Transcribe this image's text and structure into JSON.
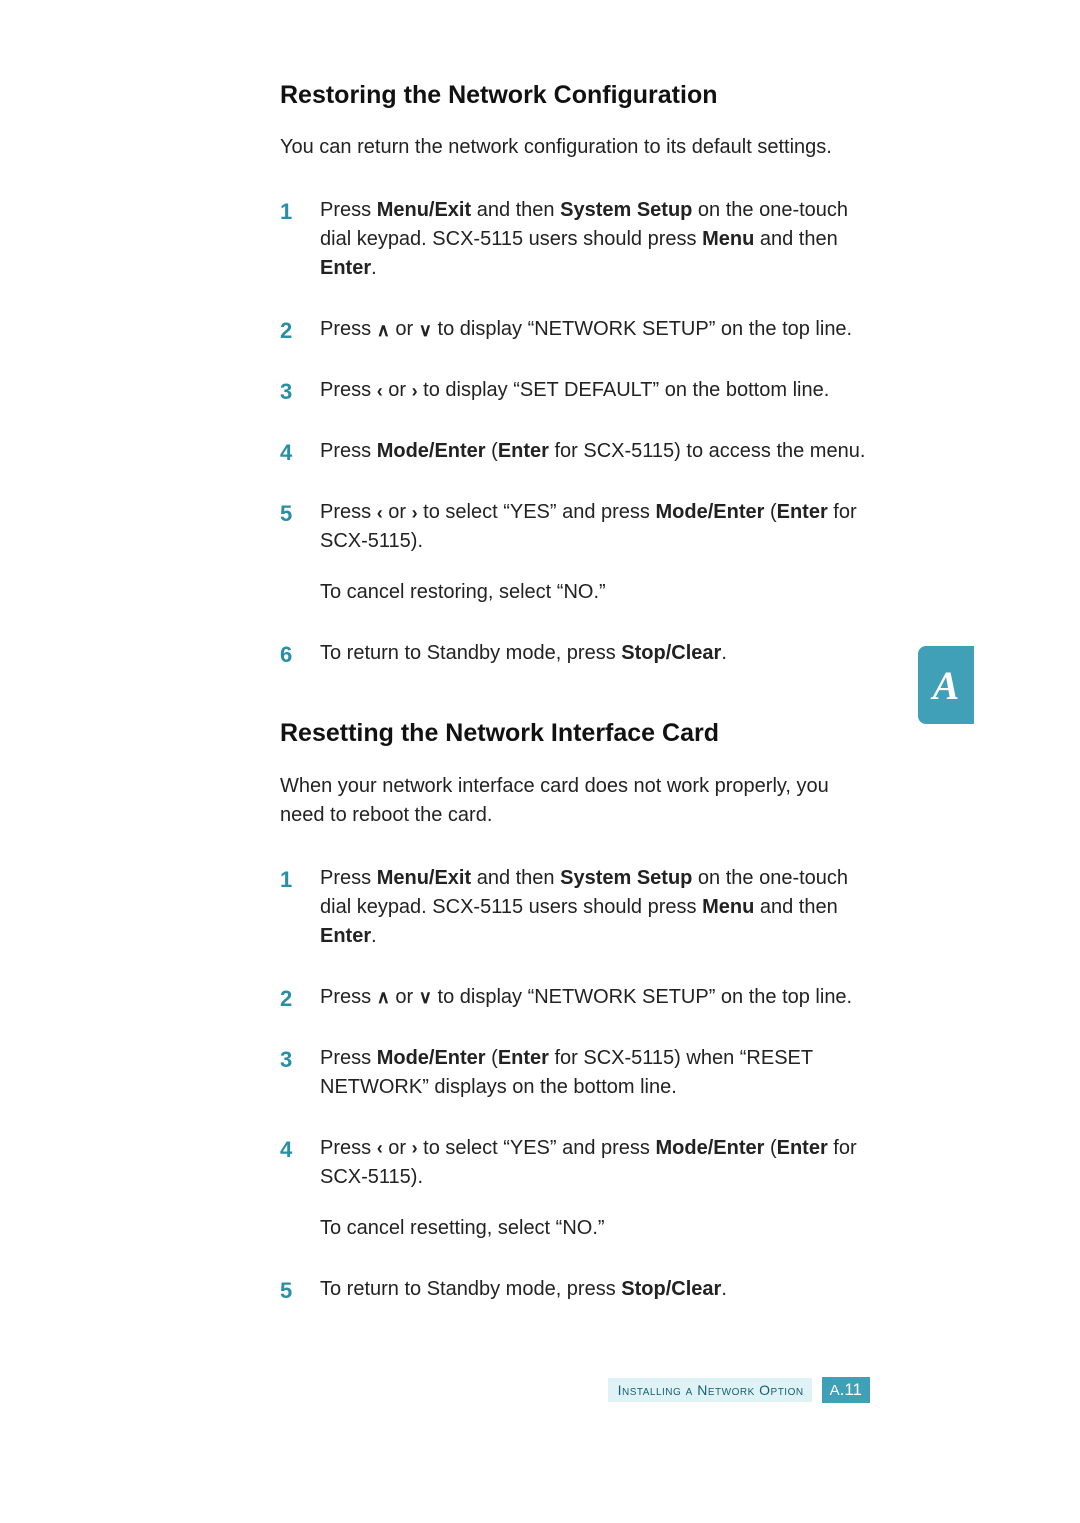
{
  "section1": {
    "heading": "Restoring the Network Configuration",
    "intro": "You can return the network configuration to its default settings.",
    "steps": [
      {
        "num": "1",
        "parts": [
          {
            "t": "Press "
          },
          {
            "t": "Menu/Exit",
            "b": true
          },
          {
            "t": " and then "
          },
          {
            "t": "System Setup",
            "b": true
          },
          {
            "t": " on the one-touch dial keypad. SCX-5115 users should press "
          },
          {
            "t": "Menu",
            "b": true
          },
          {
            "t": " and then "
          },
          {
            "t": "Enter",
            "b": true
          },
          {
            "t": "."
          }
        ]
      },
      {
        "num": "2",
        "parts": [
          {
            "t": "Press "
          },
          {
            "arrow": "up"
          },
          {
            "t": " or "
          },
          {
            "arrow": "down"
          },
          {
            "t": " to display “NETWORK SETUP” on the top line."
          }
        ]
      },
      {
        "num": "3",
        "parts": [
          {
            "t": "Press "
          },
          {
            "arrow": "left"
          },
          {
            "t": " or "
          },
          {
            "arrow": "right"
          },
          {
            "t": " to display “SET DEFAULT” on the bottom line."
          }
        ]
      },
      {
        "num": "4",
        "parts": [
          {
            "t": "Press "
          },
          {
            "t": "Mode/Enter",
            "b": true
          },
          {
            "t": " ("
          },
          {
            "t": "Enter",
            "b": true
          },
          {
            "t": " for SCX-5115) to access the menu."
          }
        ]
      },
      {
        "num": "5",
        "parts": [
          {
            "t": "Press "
          },
          {
            "arrow": "left"
          },
          {
            "t": " or "
          },
          {
            "arrow": "right"
          },
          {
            "t": " to select “YES” and press "
          },
          {
            "t": "Mode/Enter",
            "b": true
          },
          {
            "t": " ("
          },
          {
            "t": "Enter",
            "b": true
          },
          {
            "t": " for SCX-5115)."
          }
        ],
        "sub": "To cancel restoring, select “NO.”"
      },
      {
        "num": "6",
        "parts": [
          {
            "t": "To return to Standby mode, press "
          },
          {
            "t": "Stop/Clear",
            "b": true
          },
          {
            "t": "."
          }
        ]
      }
    ]
  },
  "section2": {
    "heading": "Resetting the Network Interface Card",
    "intro": "When your network interface card does not work properly, you need to reboot the card.",
    "steps": [
      {
        "num": "1",
        "parts": [
          {
            "t": "Press "
          },
          {
            "t": "Menu/Exit",
            "b": true
          },
          {
            "t": " and then "
          },
          {
            "t": "System Setup",
            "b": true
          },
          {
            "t": " on the one-touch dial keypad. SCX-5115 users should press "
          },
          {
            "t": "Menu",
            "b": true
          },
          {
            "t": " and then "
          },
          {
            "t": "Enter",
            "b": true
          },
          {
            "t": "."
          }
        ]
      },
      {
        "num": "2",
        "parts": [
          {
            "t": "Press "
          },
          {
            "arrow": "up"
          },
          {
            "t": " or "
          },
          {
            "arrow": "down"
          },
          {
            "t": " to display “NETWORK SETUP” on the top line."
          }
        ]
      },
      {
        "num": "3",
        "parts": [
          {
            "t": "Press "
          },
          {
            "t": "Mode/Enter",
            "b": true
          },
          {
            "t": " ("
          },
          {
            "t": "Enter",
            "b": true
          },
          {
            "t": " for SCX-5115) when “RESET NETWORK” displays on the bottom line."
          }
        ]
      },
      {
        "num": "4",
        "parts": [
          {
            "t": "Press "
          },
          {
            "arrow": "left"
          },
          {
            "t": " or "
          },
          {
            "arrow": "right"
          },
          {
            "t": " to select “YES” and press "
          },
          {
            "t": "Mode/Enter",
            "b": true
          },
          {
            "t": " ("
          },
          {
            "t": "Enter",
            "b": true
          },
          {
            "t": " for SCX-5115)."
          }
        ],
        "sub": "To cancel resetting, select “NO.”"
      },
      {
        "num": "5",
        "parts": [
          {
            "t": "To return to Standby mode, press "
          },
          {
            "t": "Stop/Clear",
            "b": true
          },
          {
            "t": "."
          }
        ]
      }
    ]
  },
  "side_tab": "A",
  "footer": {
    "text": "Installing a Network Option",
    "page_prefix": "A",
    "page_num": "11"
  },
  "arrows": {
    "up": "∧",
    "down": "∨",
    "left": "‹",
    "right": "›"
  }
}
